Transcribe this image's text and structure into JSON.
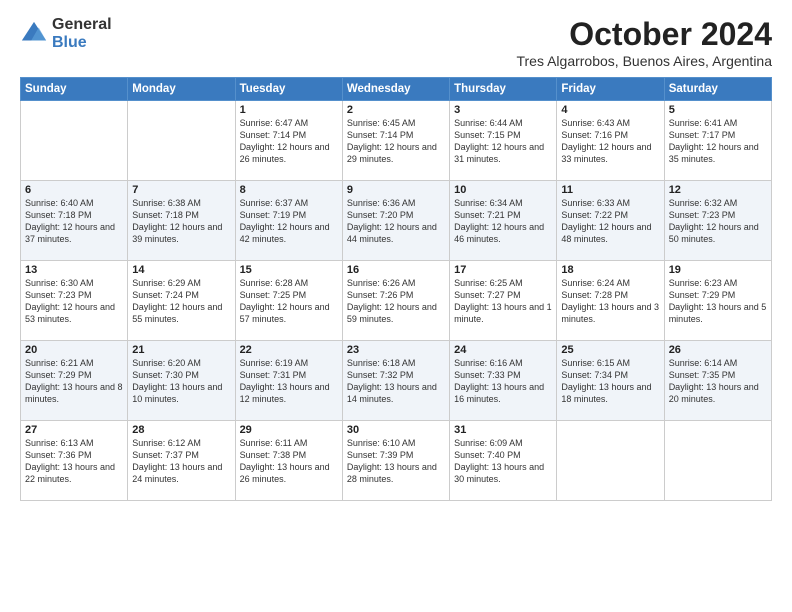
{
  "logo": {
    "general": "General",
    "blue": "Blue"
  },
  "header": {
    "month": "October 2024",
    "location": "Tres Algarrobos, Buenos Aires, Argentina"
  },
  "days_of_week": [
    "Sunday",
    "Monday",
    "Tuesday",
    "Wednesday",
    "Thursday",
    "Friday",
    "Saturday"
  ],
  "weeks": [
    [
      {
        "day": "",
        "info": ""
      },
      {
        "day": "",
        "info": ""
      },
      {
        "day": "1",
        "info": "Sunrise: 6:47 AM\nSunset: 7:14 PM\nDaylight: 12 hours and 26 minutes."
      },
      {
        "day": "2",
        "info": "Sunrise: 6:45 AM\nSunset: 7:14 PM\nDaylight: 12 hours and 29 minutes."
      },
      {
        "day": "3",
        "info": "Sunrise: 6:44 AM\nSunset: 7:15 PM\nDaylight: 12 hours and 31 minutes."
      },
      {
        "day": "4",
        "info": "Sunrise: 6:43 AM\nSunset: 7:16 PM\nDaylight: 12 hours and 33 minutes."
      },
      {
        "day": "5",
        "info": "Sunrise: 6:41 AM\nSunset: 7:17 PM\nDaylight: 12 hours and 35 minutes."
      }
    ],
    [
      {
        "day": "6",
        "info": "Sunrise: 6:40 AM\nSunset: 7:18 PM\nDaylight: 12 hours and 37 minutes."
      },
      {
        "day": "7",
        "info": "Sunrise: 6:38 AM\nSunset: 7:18 PM\nDaylight: 12 hours and 39 minutes."
      },
      {
        "day": "8",
        "info": "Sunrise: 6:37 AM\nSunset: 7:19 PM\nDaylight: 12 hours and 42 minutes."
      },
      {
        "day": "9",
        "info": "Sunrise: 6:36 AM\nSunset: 7:20 PM\nDaylight: 12 hours and 44 minutes."
      },
      {
        "day": "10",
        "info": "Sunrise: 6:34 AM\nSunset: 7:21 PM\nDaylight: 12 hours and 46 minutes."
      },
      {
        "day": "11",
        "info": "Sunrise: 6:33 AM\nSunset: 7:22 PM\nDaylight: 12 hours and 48 minutes."
      },
      {
        "day": "12",
        "info": "Sunrise: 6:32 AM\nSunset: 7:23 PM\nDaylight: 12 hours and 50 minutes."
      }
    ],
    [
      {
        "day": "13",
        "info": "Sunrise: 6:30 AM\nSunset: 7:23 PM\nDaylight: 12 hours and 53 minutes."
      },
      {
        "day": "14",
        "info": "Sunrise: 6:29 AM\nSunset: 7:24 PM\nDaylight: 12 hours and 55 minutes."
      },
      {
        "day": "15",
        "info": "Sunrise: 6:28 AM\nSunset: 7:25 PM\nDaylight: 12 hours and 57 minutes."
      },
      {
        "day": "16",
        "info": "Sunrise: 6:26 AM\nSunset: 7:26 PM\nDaylight: 12 hours and 59 minutes."
      },
      {
        "day": "17",
        "info": "Sunrise: 6:25 AM\nSunset: 7:27 PM\nDaylight: 13 hours and 1 minute."
      },
      {
        "day": "18",
        "info": "Sunrise: 6:24 AM\nSunset: 7:28 PM\nDaylight: 13 hours and 3 minutes."
      },
      {
        "day": "19",
        "info": "Sunrise: 6:23 AM\nSunset: 7:29 PM\nDaylight: 13 hours and 5 minutes."
      }
    ],
    [
      {
        "day": "20",
        "info": "Sunrise: 6:21 AM\nSunset: 7:29 PM\nDaylight: 13 hours and 8 minutes."
      },
      {
        "day": "21",
        "info": "Sunrise: 6:20 AM\nSunset: 7:30 PM\nDaylight: 13 hours and 10 minutes."
      },
      {
        "day": "22",
        "info": "Sunrise: 6:19 AM\nSunset: 7:31 PM\nDaylight: 13 hours and 12 minutes."
      },
      {
        "day": "23",
        "info": "Sunrise: 6:18 AM\nSunset: 7:32 PM\nDaylight: 13 hours and 14 minutes."
      },
      {
        "day": "24",
        "info": "Sunrise: 6:16 AM\nSunset: 7:33 PM\nDaylight: 13 hours and 16 minutes."
      },
      {
        "day": "25",
        "info": "Sunrise: 6:15 AM\nSunset: 7:34 PM\nDaylight: 13 hours and 18 minutes."
      },
      {
        "day": "26",
        "info": "Sunrise: 6:14 AM\nSunset: 7:35 PM\nDaylight: 13 hours and 20 minutes."
      }
    ],
    [
      {
        "day": "27",
        "info": "Sunrise: 6:13 AM\nSunset: 7:36 PM\nDaylight: 13 hours and 22 minutes."
      },
      {
        "day": "28",
        "info": "Sunrise: 6:12 AM\nSunset: 7:37 PM\nDaylight: 13 hours and 24 minutes."
      },
      {
        "day": "29",
        "info": "Sunrise: 6:11 AM\nSunset: 7:38 PM\nDaylight: 13 hours and 26 minutes."
      },
      {
        "day": "30",
        "info": "Sunrise: 6:10 AM\nSunset: 7:39 PM\nDaylight: 13 hours and 28 minutes."
      },
      {
        "day": "31",
        "info": "Sunrise: 6:09 AM\nSunset: 7:40 PM\nDaylight: 13 hours and 30 minutes."
      },
      {
        "day": "",
        "info": ""
      },
      {
        "day": "",
        "info": ""
      }
    ]
  ]
}
